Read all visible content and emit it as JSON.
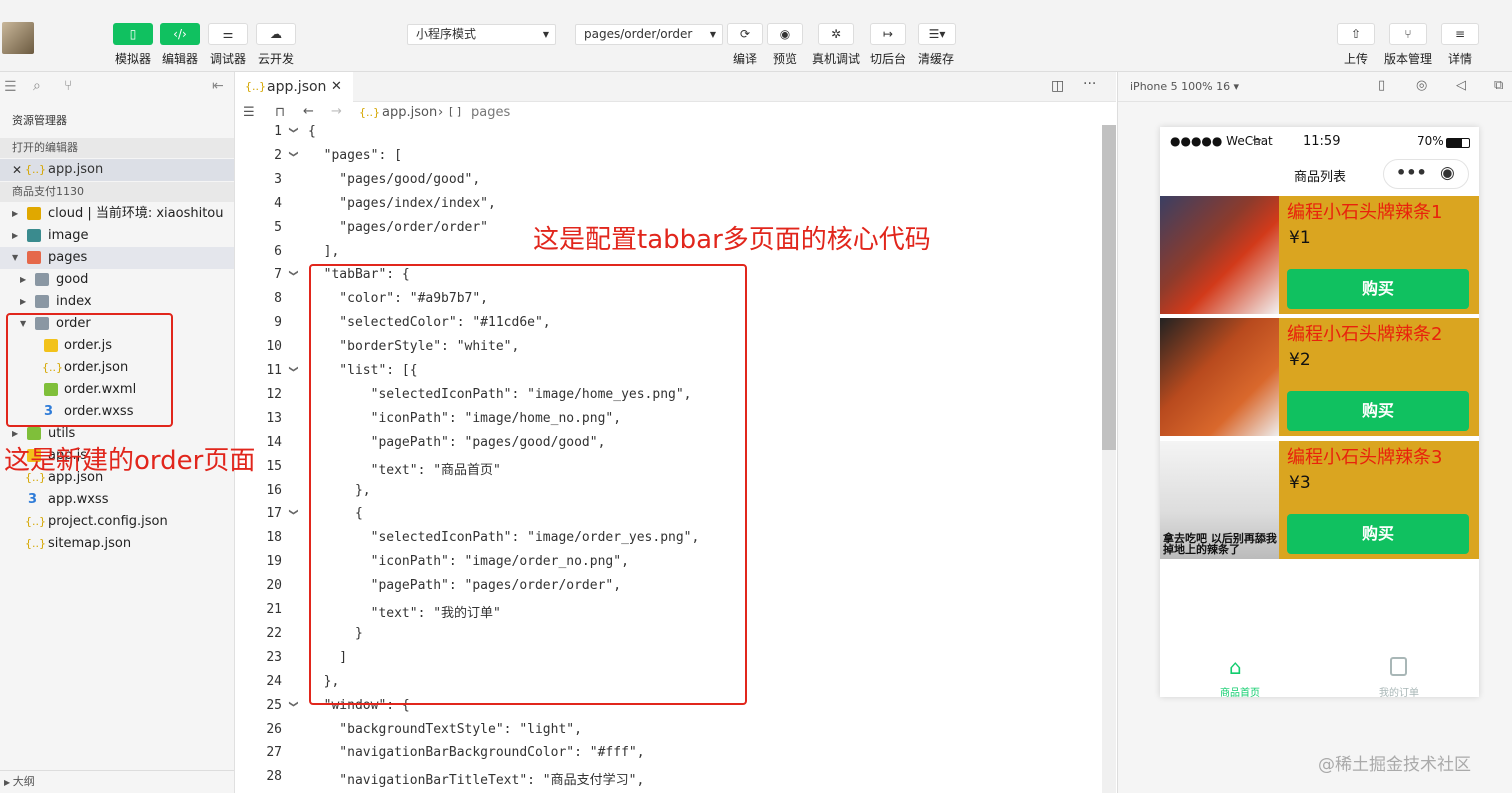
{
  "toolbar": {
    "buttons": [
      {
        "label": "模拟器"
      },
      {
        "label": "编辑器"
      },
      {
        "label": "调试器"
      },
      {
        "label": "云开发"
      }
    ],
    "mode_select": "小程序模式",
    "page_select": "pages/order/order",
    "mid_buttons": [
      {
        "label": "编译"
      },
      {
        "label": "预览"
      },
      {
        "label": "真机调试"
      },
      {
        "label": "切后台"
      },
      {
        "label": "清缓存"
      }
    ],
    "right_buttons": [
      {
        "label": "上传"
      },
      {
        "label": "版本管理"
      },
      {
        "label": "详情"
      }
    ]
  },
  "sidebar": {
    "title": "资源管理器",
    "open_editors": "打开的编辑器",
    "open_file": "app.json",
    "project": "商品支付1130",
    "tree": [
      {
        "label": "cloud | 当前环境: xiaoshitou"
      },
      {
        "label": "image"
      },
      {
        "label": "pages"
      },
      {
        "label": "good"
      },
      {
        "label": "index"
      },
      {
        "label": "order"
      },
      {
        "label": "order.js"
      },
      {
        "label": "order.json"
      },
      {
        "label": "order.wxml"
      },
      {
        "label": "order.wxss"
      },
      {
        "label": "utils"
      },
      {
        "label": "app.js"
      },
      {
        "label": "app.json"
      },
      {
        "label": "app.wxss"
      },
      {
        "label": "project.config.json"
      },
      {
        "label": "sitemap.json"
      }
    ],
    "outline": "大纲"
  },
  "editor": {
    "tab": "app.json",
    "breadcrumb_file": "app.json",
    "breadcrumb_node": "pages",
    "lines": [
      "{",
      "  \"pages\": [",
      "    \"pages/good/good\",",
      "    \"pages/index/index\",",
      "    \"pages/order/order\"",
      "  ],",
      "  \"tabBar\": {",
      "    \"color\": \"#a9b7b7\",",
      "    \"selectedColor\": \"#11cd6e\",",
      "    \"borderStyle\": \"white\",",
      "    \"list\": [{",
      "        \"selectedIconPath\": \"image/home_yes.png\",",
      "        \"iconPath\": \"image/home_no.png\",",
      "        \"pagePath\": \"pages/good/good\",",
      "        \"text\": \"商品首页\"",
      "      },",
      "      {",
      "        \"selectedIconPath\": \"image/order_yes.png\",",
      "        \"iconPath\": \"image/order_no.png\",",
      "        \"pagePath\": \"pages/order/order\",",
      "        \"text\": \"我的订单\"",
      "      }",
      "    ]",
      "  },",
      "  \"window\": {",
      "    \"backgroundTextStyle\": \"light\",",
      "    \"navigationBarBackgroundColor\": \"#fff\",",
      "    \"navigationBarTitleText\": \"商品支付学习\","
    ],
    "line_numbers": [
      "1",
      "2",
      "3",
      "4",
      "5",
      "6",
      "7",
      "8",
      "9",
      "10",
      "11",
      "12",
      "13",
      "14",
      "15",
      "16",
      "17",
      "18",
      "19",
      "20",
      "21",
      "22",
      "23",
      "24",
      "25",
      "26",
      "27",
      "28"
    ]
  },
  "annotations": {
    "tabbar_note": "这是配置tabbar多页面的核心代码",
    "order_note": "这是新建的order页面"
  },
  "simulator": {
    "device": "iPhone 5 100% 16 ▾",
    "carrier": "●●●●● WeChat",
    "time": "11:59",
    "battery": "70%",
    "nav_title": "商品列表",
    "products": [
      {
        "name": "编程小石头牌辣条1",
        "price": "¥1",
        "button": "购买"
      },
      {
        "name": "编程小石头牌辣条2",
        "price": "¥2",
        "button": "购买"
      },
      {
        "name": "编程小石头牌辣条3",
        "price": "¥3",
        "button": "购买"
      }
    ],
    "meme_text": "拿去吃吧  以后别再舔我掉地上的辣条了",
    "tabs": [
      {
        "label": "商品首页"
      },
      {
        "label": "我的订单"
      }
    ]
  },
  "watermark": "@稀土掘金技术社区",
  "colors": {
    "accent": "#11cd6e",
    "red": "#e1261c",
    "product_bg": "#daa520"
  }
}
